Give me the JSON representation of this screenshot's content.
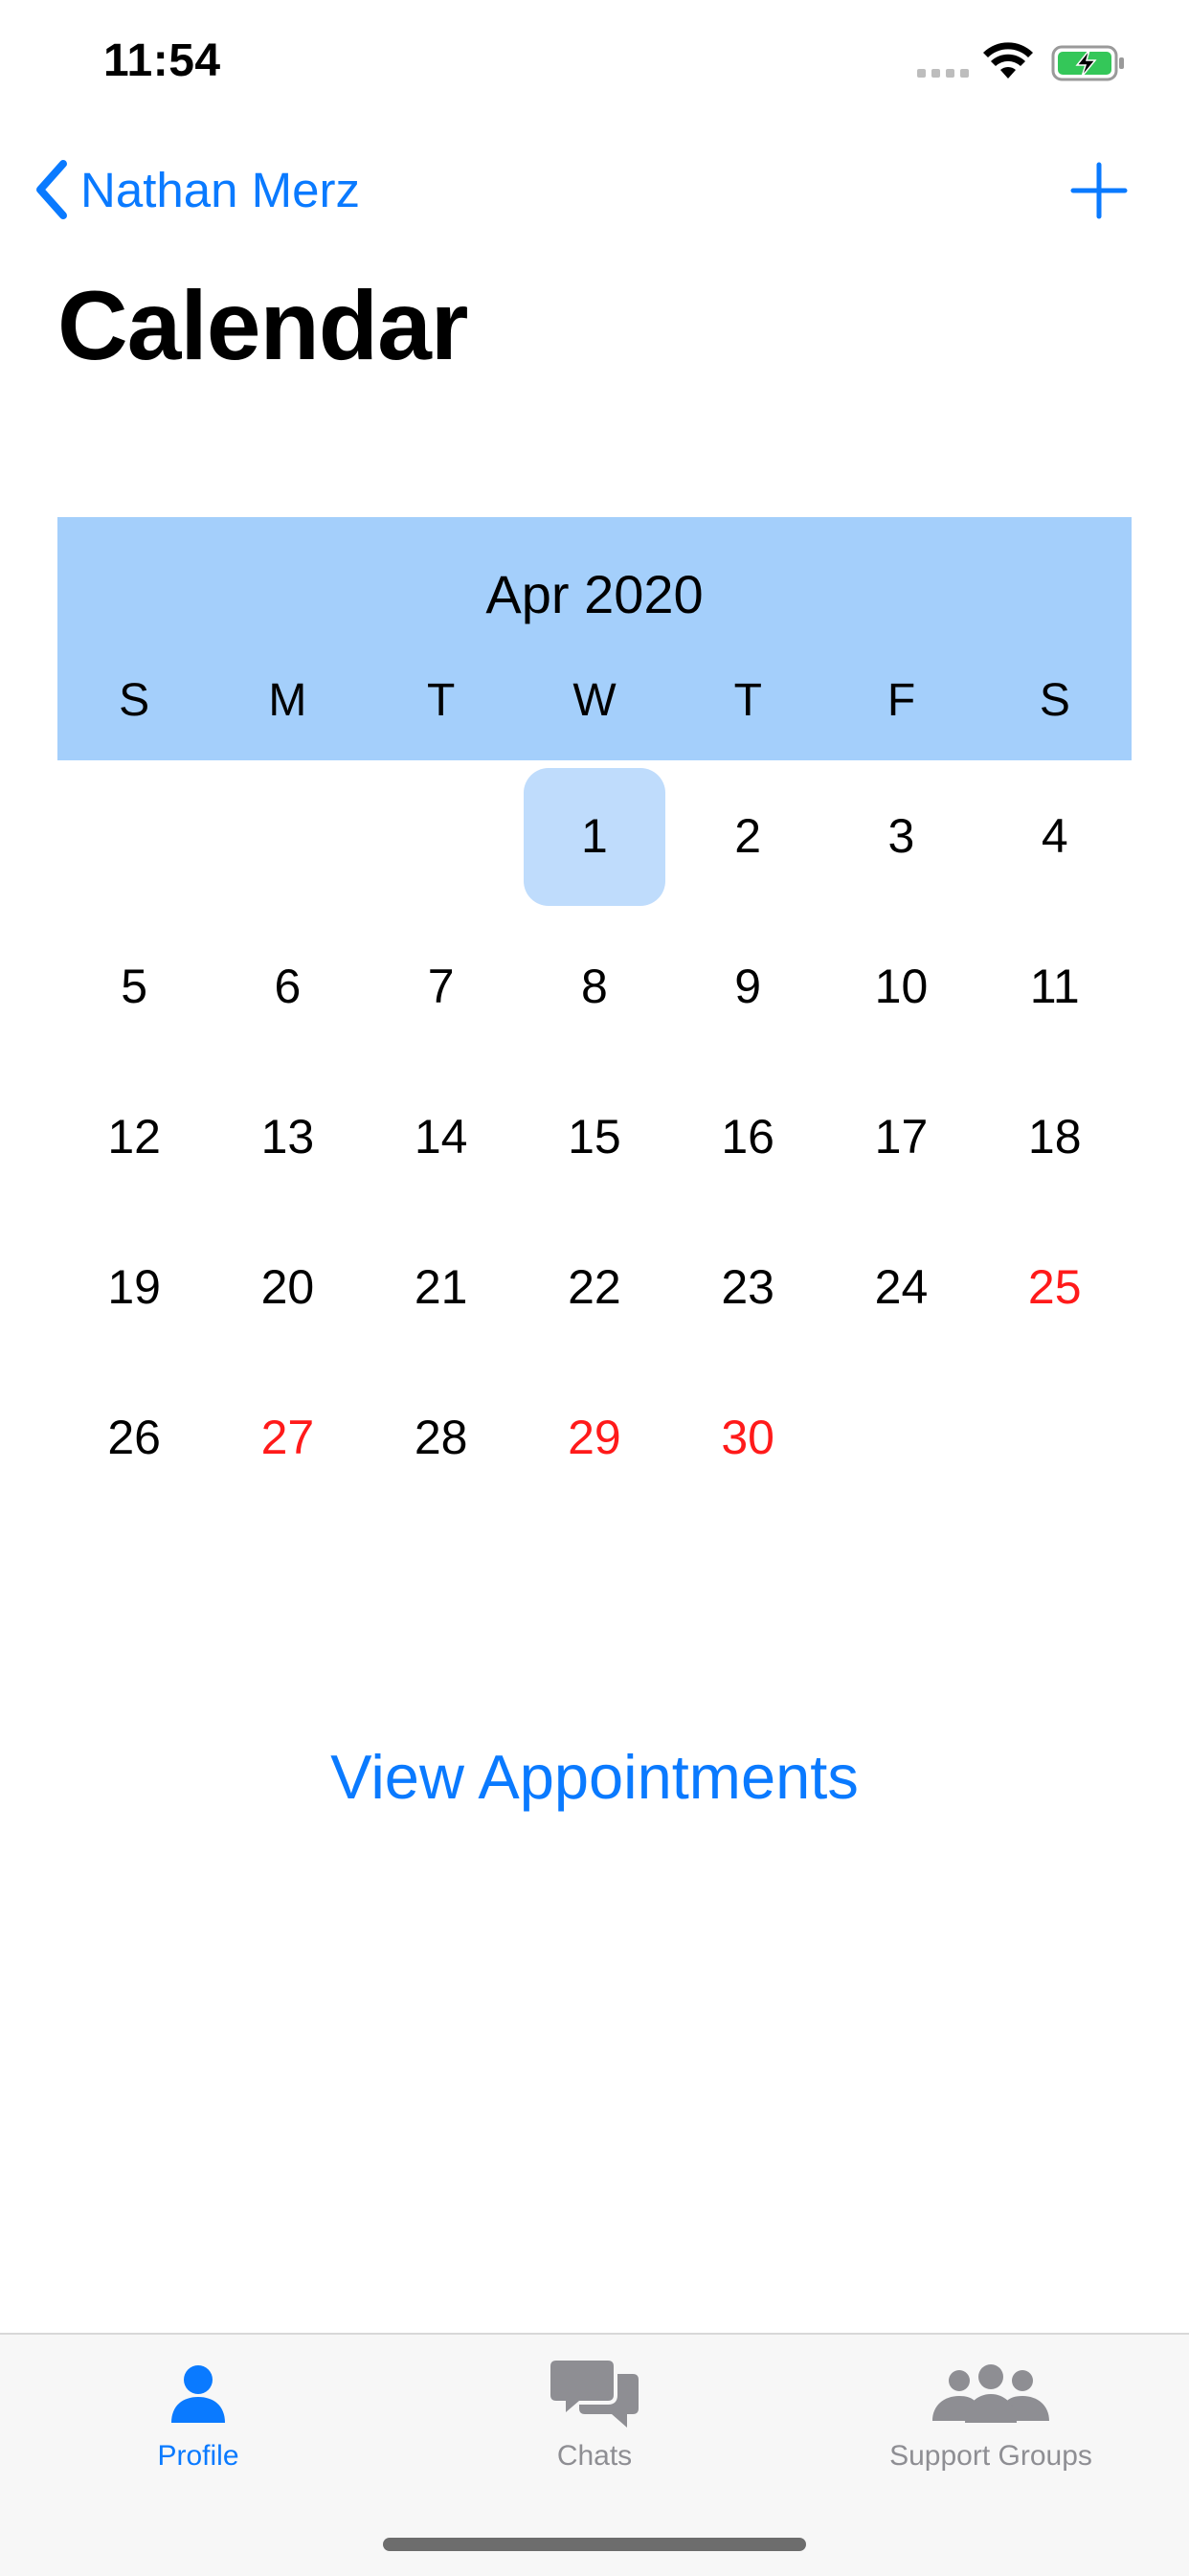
{
  "status_bar": {
    "time": "11:54"
  },
  "nav": {
    "back_label": "Nathan Merz",
    "title": "Calendar"
  },
  "calendar": {
    "month_label": "Apr 2020",
    "weekdays": [
      "S",
      "M",
      "T",
      "W",
      "T",
      "F",
      "S"
    ],
    "weeks": [
      [
        "",
        "",
        "",
        "1",
        "2",
        "3",
        "4"
      ],
      [
        "5",
        "6",
        "7",
        "8",
        "9",
        "10",
        "11"
      ],
      [
        "12",
        "13",
        "14",
        "15",
        "16",
        "17",
        "18"
      ],
      [
        "19",
        "20",
        "21",
        "22",
        "23",
        "24",
        "25"
      ],
      [
        "26",
        "27",
        "28",
        "29",
        "30",
        "",
        ""
      ]
    ],
    "selected_day": "1",
    "highlighted_days": [
      "25",
      "27",
      "29",
      "30"
    ]
  },
  "actions": {
    "view_appointments": "View Appointments"
  },
  "tab_bar": {
    "items": [
      {
        "label": "Profile",
        "icon": "person-icon",
        "active": true
      },
      {
        "label": "Chats",
        "icon": "chat-bubbles-icon",
        "active": false
      },
      {
        "label": "Support Groups",
        "icon": "group-icon",
        "active": false
      }
    ]
  },
  "colors": {
    "accent": "#0a7aff",
    "calendar_header": "#a4cffb",
    "selected_day": "#bfdcfc",
    "highlight_day": "#ff1a1a",
    "inactive_tab": "#8e8e93"
  }
}
